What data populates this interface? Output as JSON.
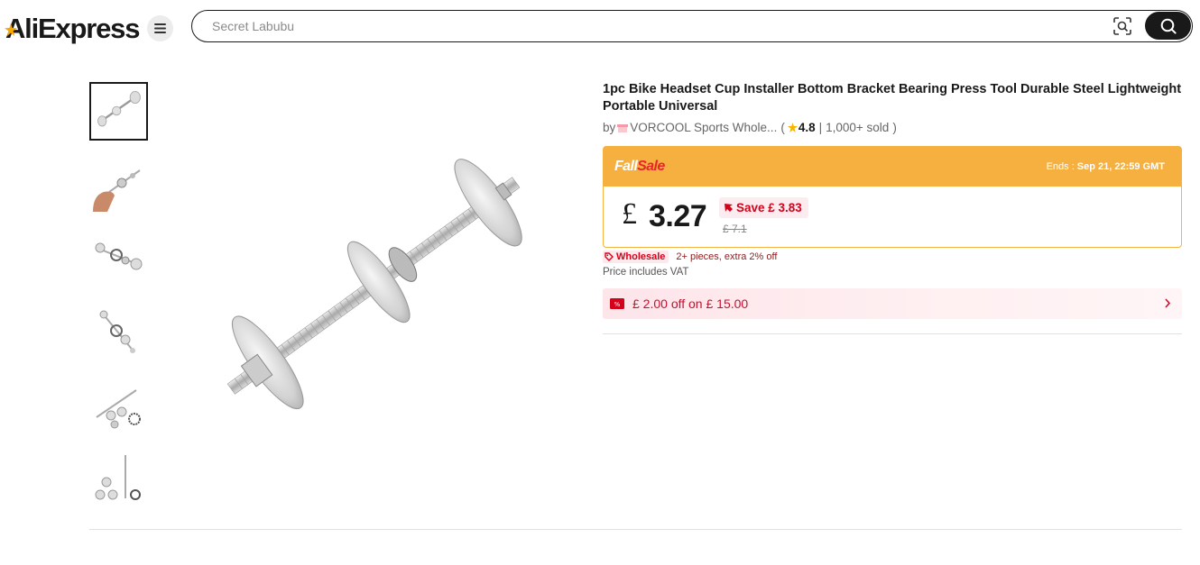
{
  "header": {
    "logo_text": "AliExpress",
    "menu_icon": "hamburger-icon",
    "search_placeholder": "Secret Labubu",
    "camera_icon": "image-search-icon",
    "search_icon": "search-icon"
  },
  "gallery": {
    "thumbnails": [
      "thumb-1",
      "thumb-2",
      "thumb-3",
      "thumb-4",
      "thumb-5",
      "thumb-6"
    ],
    "selected_index": 0
  },
  "product": {
    "title": "1pc Bike Headset Cup Installer Bottom Bracket Bearing Press Tool Durable Steel Lightweight Portable Universal",
    "by_label": "by",
    "store_name": "VORCOOL Sports Whole...",
    "rating": "4.8",
    "sold": "1,000+ sold",
    "rating_open": "(",
    "rating_sep": "|",
    "rating_close": ")"
  },
  "sale": {
    "name_part1": "Fall",
    "name_part2": "Sale",
    "ends_label": "Ends :",
    "ends_value": "Sep 21, 22:59 GMT",
    "currency": "£",
    "price": "3.27",
    "save_label": "Save £ 3.83",
    "original_price": "£ 7.1"
  },
  "wholesale": {
    "tag": "Wholesale",
    "text": "2+ pieces, extra 2% off"
  },
  "vat_text": "Price includes VAT",
  "coupon": {
    "text": "£ 2.00 off on £ 15.00"
  },
  "colors": {
    "sale_orange": "#f5b040",
    "sale_red": "#e8252a",
    "discount_red": "#d3031c"
  }
}
